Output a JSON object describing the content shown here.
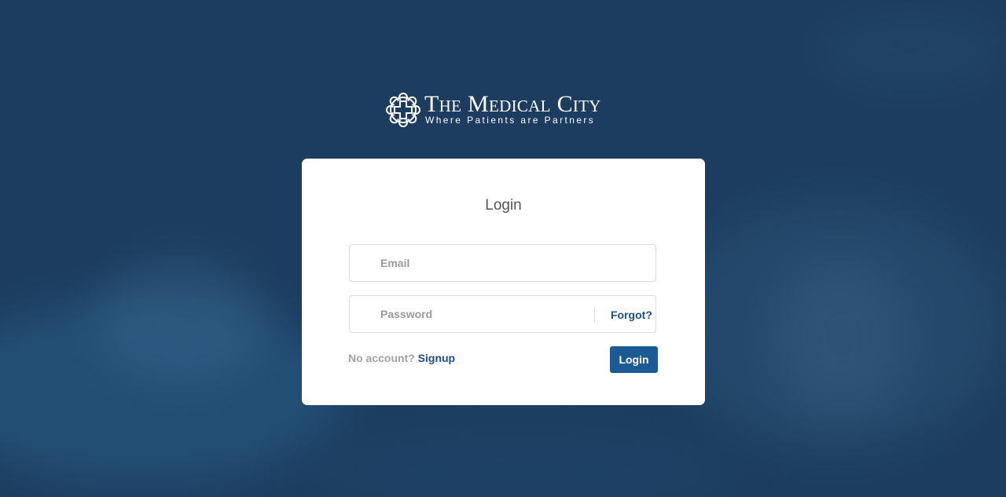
{
  "brand": {
    "name": "The Medical City",
    "tagline": "Where Patients are Partners",
    "logo_icon": "medical-city-emblem-icon"
  },
  "login_card": {
    "title": "Login",
    "email_placeholder": "Email",
    "email_value": "",
    "password_placeholder": "Password",
    "password_value": "",
    "forgot_label": "Forgot?",
    "no_account_text": "No account?",
    "signup_label": "Signup",
    "login_button_label": "Login"
  },
  "colors": {
    "background": "#1c3d5f",
    "accent": "#1c5a93",
    "link": "#1c4f86",
    "card": "#ffffff"
  }
}
